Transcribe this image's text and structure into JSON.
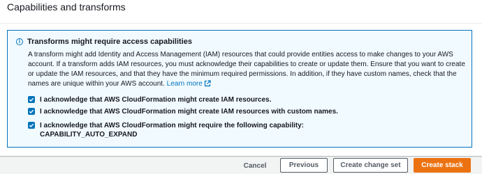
{
  "panel": {
    "title": "Capabilities and transforms"
  },
  "alert": {
    "title": "Transforms might require access capabilities",
    "icon": "info-icon",
    "body": "A transform might add Identity and Access Management (IAM) resources that could provide entities access to make changes to your AWS account. If a transform adds IAM resources, you must acknowledge their capabilities to create or update them. Ensure that you want to create or update the IAM resources, and that they have the minimum required permissions. In addition, if they have custom names, check that the names are unique within your AWS account.",
    "learn_more": "Learn more",
    "accent_color": "#0073bb",
    "background_color": "#f1faff"
  },
  "acknowledgements": [
    {
      "label": "I acknowledge that AWS CloudFormation might create IAM resources.",
      "checked": true
    },
    {
      "label": "I acknowledge that AWS CloudFormation might create IAM resources with custom names.",
      "checked": true
    },
    {
      "label": "I acknowledge that AWS CloudFormation might require the following capability:",
      "label_line2": "CAPABILITY_AUTO_EXPAND",
      "checked": true
    }
  ],
  "footer": {
    "cancel": "Cancel",
    "previous": "Previous",
    "create_change_set": "Create change set",
    "create_stack": "Create stack",
    "primary_color": "#ec7211"
  }
}
